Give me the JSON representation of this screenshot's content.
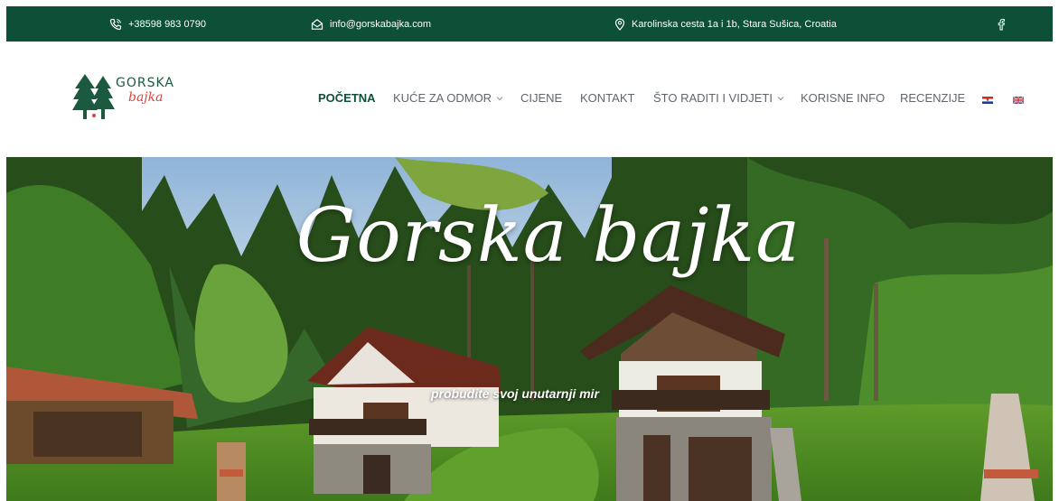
{
  "topbar": {
    "phone": "+38598 983 0790",
    "email": "info@gorskabajka.com",
    "address": "Karolinska cesta 1a i 1b, Stara Sušica, Croatia",
    "facebook_icon": "facebook-icon",
    "background": "#0d4f37"
  },
  "logo": {
    "line1": "GORSKA",
    "line2": "bajka"
  },
  "nav": {
    "items": [
      {
        "label": "POČETNA",
        "active": true
      },
      {
        "label": "KUĆE ZA ODMOR",
        "dropdown": true
      },
      {
        "label": "CIJENE"
      },
      {
        "label": "KONTAKT"
      },
      {
        "label": "ŠTO RADITI I VIDJETI",
        "dropdown": true
      },
      {
        "label": "KORISNE INFO"
      },
      {
        "label": "RECENZIJE"
      }
    ],
    "languages": [
      "croatian-flag-icon",
      "uk-flag-icon"
    ],
    "active_color": "#0d4f37"
  },
  "hero": {
    "title": "Gorska bajka",
    "subtitle": "probudite svoj unutarnji mir"
  }
}
